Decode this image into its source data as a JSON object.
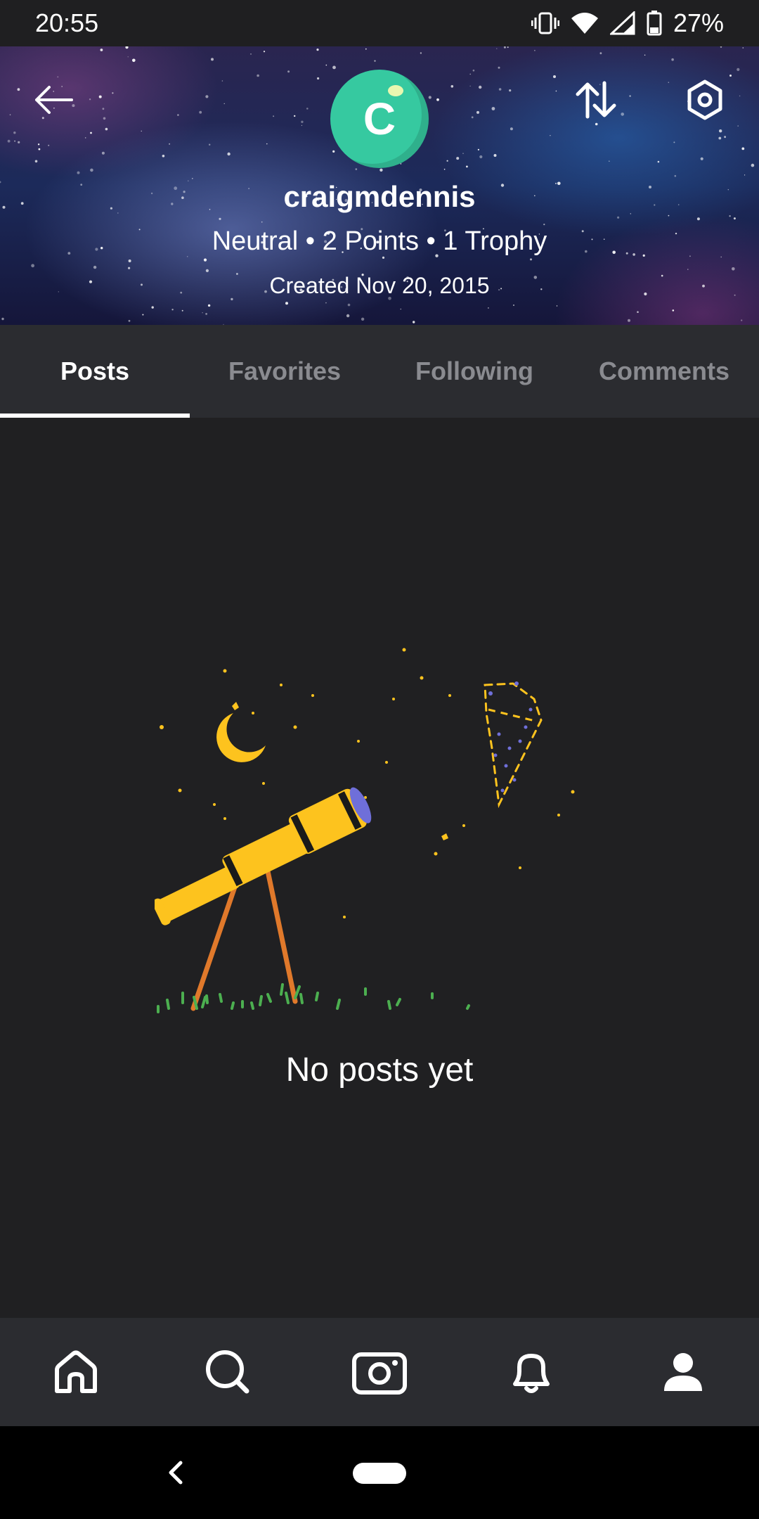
{
  "status_bar": {
    "time": "20:55",
    "battery": "27%"
  },
  "profile": {
    "avatar_letter": "C",
    "username": "craigmdennis",
    "stats": "Neutral • 2 Points • 1 Trophy",
    "created": "Created Nov 20, 2015",
    "avatar_color": "#36c9a0"
  },
  "tabs": [
    {
      "label": "Posts",
      "active": true
    },
    {
      "label": "Favorites",
      "active": false
    },
    {
      "label": "Following",
      "active": false
    },
    {
      "label": "Comments",
      "active": false
    }
  ],
  "empty_state": {
    "message": "No posts yet"
  },
  "bottom_nav": [
    {
      "icon": "home-icon"
    },
    {
      "icon": "search-icon"
    },
    {
      "icon": "camera-icon"
    },
    {
      "icon": "bell-icon"
    },
    {
      "icon": "profile-icon"
    }
  ],
  "colors": {
    "background": "#202022",
    "bar": "#2b2c30",
    "accent_yellow": "#fdc31e",
    "accent_orange": "#e0792b",
    "grass_green": "#4caf50"
  }
}
